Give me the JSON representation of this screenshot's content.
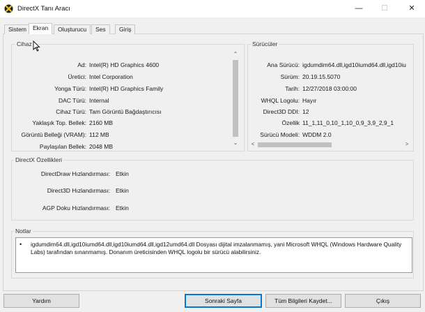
{
  "window": {
    "title": "DirectX Tanı Aracı",
    "minimize_glyph": "—",
    "maximize_glyph": "☐",
    "close_glyph": "✕"
  },
  "tabs": [
    {
      "label": "Sistem"
    },
    {
      "label": "Ekran",
      "active": true
    },
    {
      "label": "Oluşturucu"
    },
    {
      "label": "Ses"
    },
    {
      "label": "Giriş"
    }
  ],
  "device": {
    "title": "Cihaz",
    "rows": [
      {
        "label": "Ad:",
        "value": "Intel(R) HD Graphics 4600"
      },
      {
        "label": "Üretici:",
        "value": "Intel Corporation"
      },
      {
        "label": "Yonga Türü:",
        "value": "Intel(R) HD Graphics Family"
      },
      {
        "label": "DAC Türü:",
        "value": "Internal"
      },
      {
        "label": "Cihaz Türü:",
        "value": "Tam Görüntü Bağdaştırıcısı"
      },
      {
        "label": "Yaklaşık Top. Bellek:",
        "value": "2160 MB"
      },
      {
        "label": "Görüntü Belleği (VRAM):",
        "value": "112 MB"
      },
      {
        "label": "Paylaşılan Bellek:",
        "value": "2048 MB"
      }
    ]
  },
  "drivers": {
    "title": "Sürücüler",
    "rows": [
      {
        "label": "Ana Sürücü:",
        "value": "igdumdim64.dll,igd10iumd64.dll,igd10iu"
      },
      {
        "label": "Sürüm:",
        "value": "20.19.15.5070"
      },
      {
        "label": "Tarih:",
        "value": "12/27/2018 03:00:00"
      },
      {
        "label": "WHQL Logolu:",
        "value": "Hayır"
      },
      {
        "label": "Direct3D DDI:",
        "value": "12"
      },
      {
        "label": "Özellik",
        "value": "11_1,11_0,10_1,10_0,9_3,9_2,9_1"
      },
      {
        "label": "Sürücü Modeli:",
        "value": "WDDM 2.0"
      }
    ]
  },
  "directx_features": {
    "title": "DirectX Özellikleri",
    "rows": [
      {
        "label": "DirectDraw Hızlandırması:",
        "value": "Etkin"
      },
      {
        "label": "Direct3D Hızlandırması:",
        "value": "Etkin"
      },
      {
        "label": "AGP Doku Hızlandırması:",
        "value": "Etkin"
      }
    ]
  },
  "notes": {
    "title": "Notlar",
    "bullet": "•",
    "text": "igdumdim64.dll,igd10iumd64.dll,igd10iumd64.dll,igd12umd64.dll Dosyası dijital imzalanmamış, yani Microsoft WHQL (Windows Hardware Quality Labs) tarafından sınanmamış. Donanım üreticisinden WHQL logolu bir sürücü alabilirsiniz."
  },
  "buttons": {
    "help": "Yardım",
    "next_page": "Sonraki Sayfa",
    "save_all": "Tüm Bilgileri Kaydet...",
    "exit": "Çıkış"
  },
  "scroll": {
    "up": "⌃",
    "down": "⌄",
    "left": "<",
    "right": ">"
  },
  "colors": {
    "accent": "#0078d7",
    "window_bg": "#f0f0f0",
    "notes_bg": "#ffffff"
  }
}
